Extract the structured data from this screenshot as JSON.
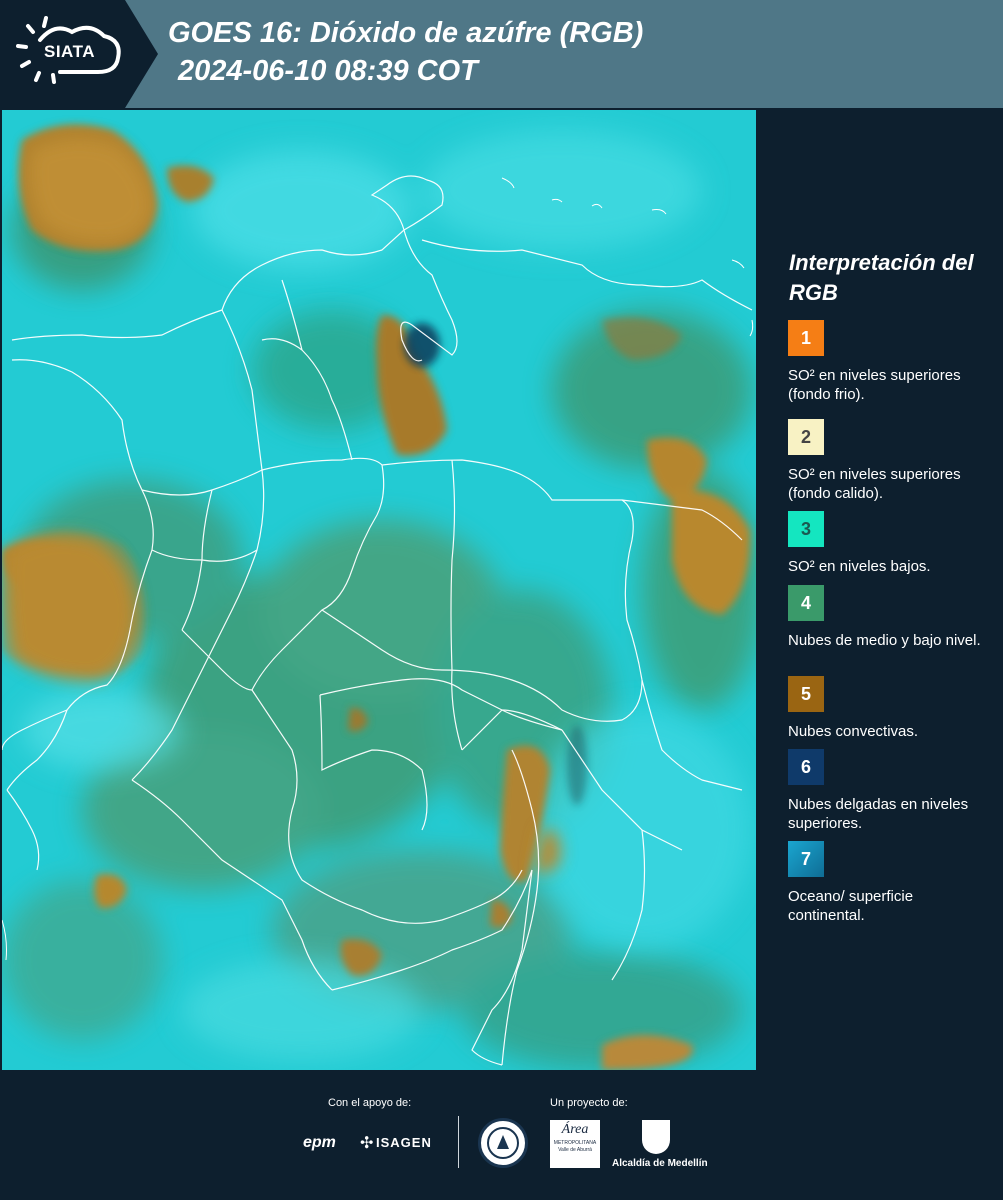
{
  "header": {
    "logo_text": "SIATA",
    "title_line1": "GOES 16: Dióxido de azúfre (RGB)",
    "title_line2": "2024-06-10 08:39 COT"
  },
  "legend": {
    "title": "Interpretación del RGB",
    "items": [
      {
        "number": "1",
        "color": "#f57e15",
        "label": "SO² en niveles superiores (fondo frio)."
      },
      {
        "number": "2",
        "color": "#f8f2c4",
        "label": "SO² en niveles superiores (fondo calido)."
      },
      {
        "number": "3",
        "color": "#14e6c0",
        "label": "SO² en niveles bajos."
      },
      {
        "number": "4",
        "color": "#3a9a6a",
        "label": "Nubes de medio y bajo nivel."
      },
      {
        "number": "5",
        "color": "#9a6512",
        "label": "Nubes convectivas."
      },
      {
        "number": "6",
        "color": "#0f3a6a",
        "label": "Nubes delgadas en niveles superiores."
      },
      {
        "number": "7",
        "color": "#1590b8",
        "label": "Oceano/ superficie continental."
      }
    ]
  },
  "footer": {
    "support_label": "Con el apoyo de:",
    "project_label": "Un proyecto de:",
    "sponsor_epm": "epm",
    "sponsor_isagen": "ISAGEN",
    "partner_area": "Área",
    "partner_area_sub": "METROPOLITANA Valle de Aburrá",
    "partner_medellin": "Alcaldía de Medellín"
  }
}
